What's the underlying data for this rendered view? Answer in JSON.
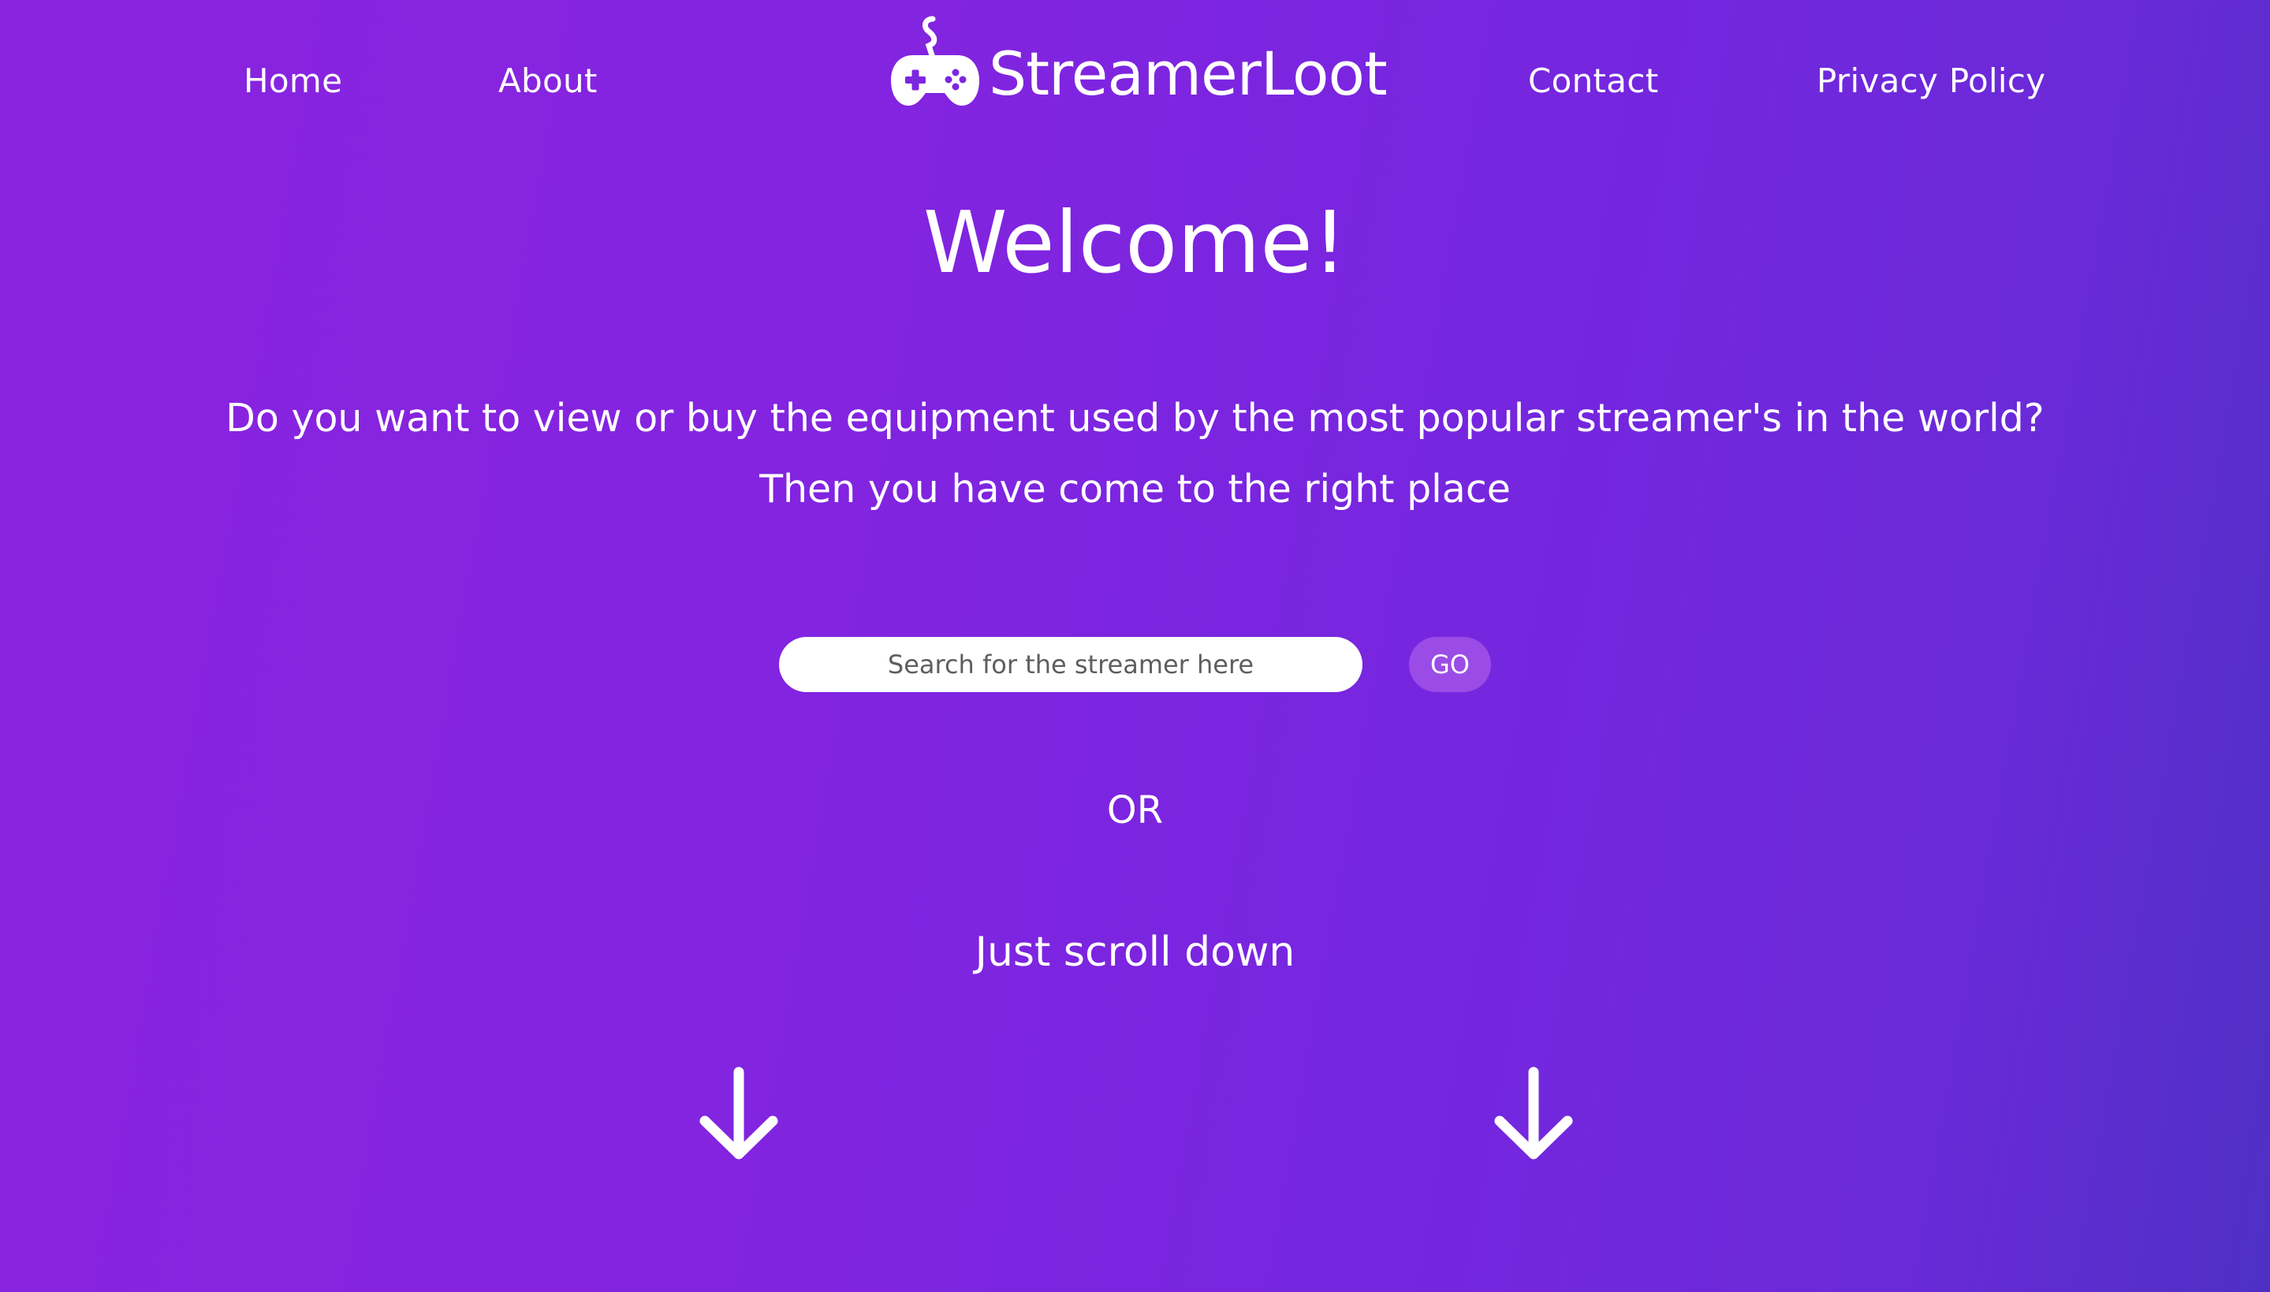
{
  "nav": {
    "home": "Home",
    "about": "About",
    "contact": "Contact",
    "privacy": "Privacy Policy"
  },
  "logo": {
    "text": "StreamerLoot",
    "icon": "gamepad-icon"
  },
  "main": {
    "title": "Welcome!",
    "intro_line1": "Do you want to view or buy the equipment used by the most popular streamer's in the world?",
    "intro_line2": "Then you have come to the right place",
    "or_text": "OR",
    "scroll_text": "Just scroll down"
  },
  "search": {
    "placeholder": "Search for the streamer here",
    "value": "",
    "button_label": "GO"
  },
  "icons": {
    "arrows": [
      "arrow-down-icon",
      "arrow-down-icon"
    ]
  },
  "colors": {
    "background_start": "#8a23e0",
    "background_end": "#4e30c4",
    "text": "#ffffff",
    "go_button": "#9b4ce6",
    "search_bg": "#ffffff"
  }
}
